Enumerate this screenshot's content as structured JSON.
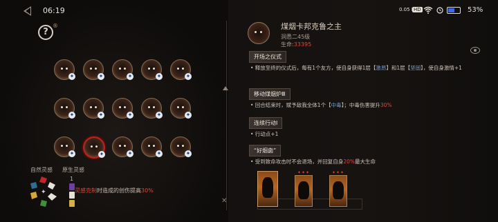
{
  "status_bar": {
    "time": "06:19",
    "speed": "0.05 KB/S",
    "network": "HD",
    "battery": "53%"
  },
  "left_panel": {
    "help_superscript": "®",
    "row_counts": [
      5,
      5,
      5
    ],
    "native_label": "自然灵感",
    "origin_label": "原生灵感",
    "hint_prefix": "灵感克制",
    "hint_middle": "时造成的创伤提高",
    "hint_value": "30%",
    "origin_number": "1"
  },
  "boss": {
    "name": "煤烟卡邦克鲁之主",
    "level": "洞悉二45级",
    "hp_label": "生命:",
    "hp_value": "33395"
  },
  "skills": [
    {
      "tag": "开场之仪式",
      "desc_parts": [
        "• 释放至终的仪式后，每有1个友方，使自身获得1层【",
        "激昂",
        "】和1层【",
        "坚固",
        "】，使自身激情+1"
      ]
    },
    {
      "tag": "移动煤烟炉Ⅲ",
      "desc_parts": [
        "• 回合结束时，赋予敌我全体1个【",
        "中毒",
        "】；中毒伤害提升",
        "30%",
        ""
      ]
    },
    {
      "tag": "连续行动Ⅰ",
      "desc_parts": [
        "• 行动点+1"
      ]
    },
    {
      "tag": "“好烟囱”",
      "desc_parts": [
        "• 受到致命攻击时不会退场，并回复自身",
        "20%",
        "最大生命"
      ]
    }
  ],
  "cards": {
    "stars": "✦✦✦"
  },
  "colors": {
    "accent_red": "#d84a3c",
    "accent_blue": "#6e9fd8",
    "selected_border": "#b7241d"
  }
}
